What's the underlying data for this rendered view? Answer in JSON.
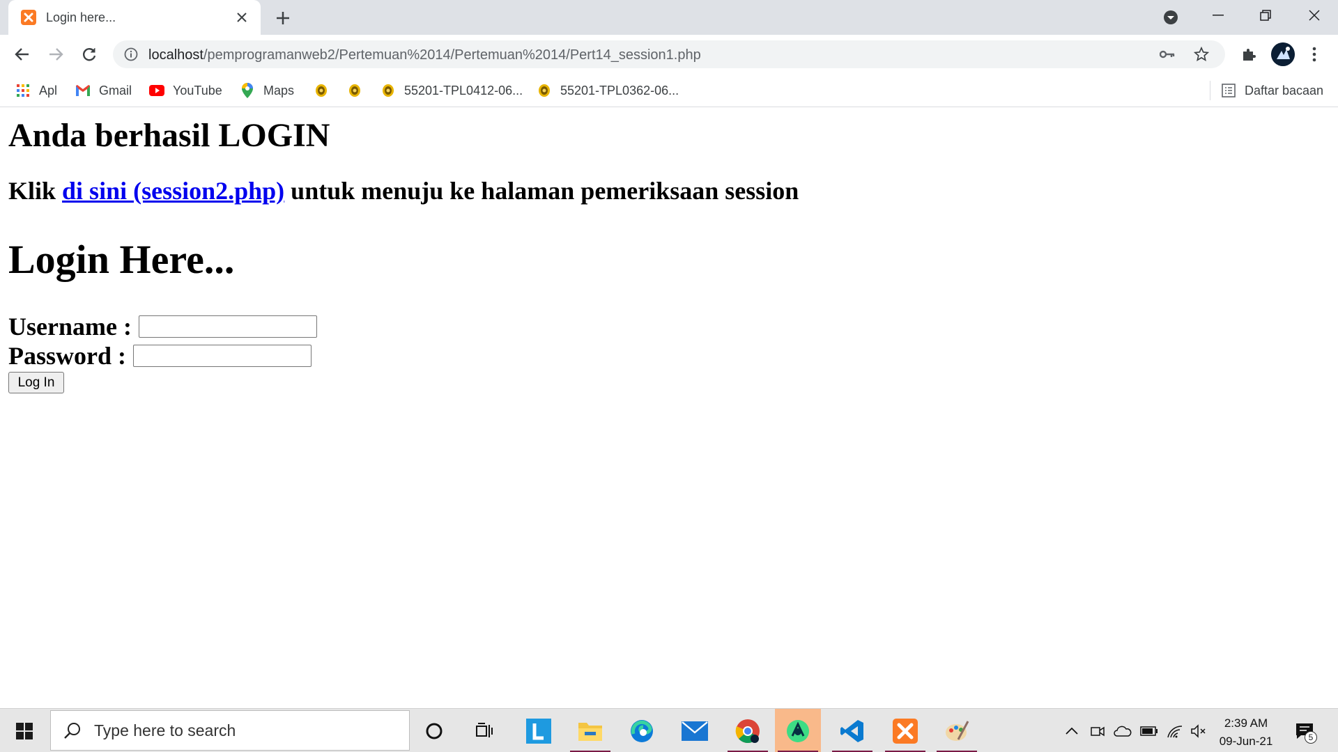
{
  "browser": {
    "tab": {
      "title": "Login here...",
      "favicon": "xampp-icon"
    },
    "address": {
      "host": "localhost",
      "path": "/pemprogramanweb2/Pertemuan%2014/Pertemuan%2014/Pert14_session1.php"
    },
    "bookmarks": [
      {
        "label": "Apl",
        "icon": "apps-grid-icon"
      },
      {
        "label": "Gmail",
        "icon": "gmail-icon"
      },
      {
        "label": "YouTube",
        "icon": "youtube-icon"
      },
      {
        "label": "Maps",
        "icon": "maps-pin-icon"
      },
      {
        "label": "",
        "icon": "site-emblem-icon"
      },
      {
        "label": "",
        "icon": "site-emblem-icon"
      },
      {
        "label": "55201-TPL0412-06...",
        "icon": "site-emblem-icon"
      },
      {
        "label": "55201-TPL0362-06...",
        "icon": "site-emblem-icon"
      }
    ],
    "reading_list": "Daftar bacaan"
  },
  "page": {
    "success_heading": "Anda berhasil LOGIN",
    "klik_prefix": "Klik ",
    "link_text": "di sini (session2.php)",
    "klik_suffix": " untuk menuju ke halaman pemeriksaan session",
    "login_heading": "Login Here...",
    "username_label": "Username :",
    "username_value": "",
    "password_label": "Password :",
    "password_value": "",
    "login_button": "Log In"
  },
  "taskbar": {
    "search_placeholder": "Type here to search",
    "time": "2:39 AM",
    "date": "09-Jun-21",
    "notification_count": "5"
  },
  "colors": {
    "link": "#0000ee",
    "tab_strip": "#dee1e6",
    "taskbar": "#e6e6e6",
    "active_app": "#f9b98a",
    "xampp_orange": "#fb7a24"
  }
}
